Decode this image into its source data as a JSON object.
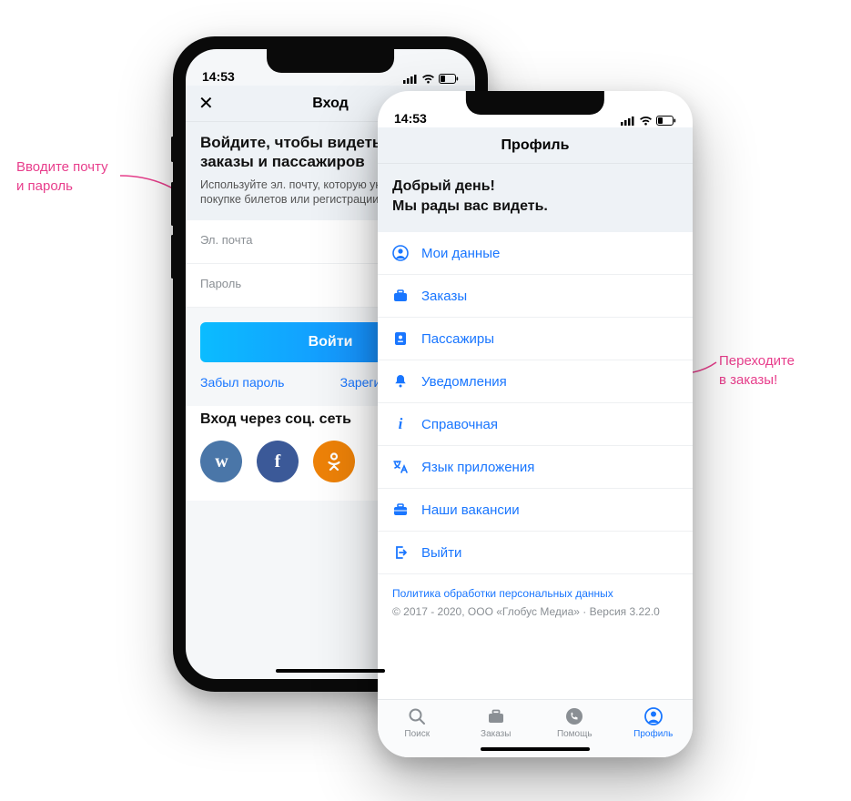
{
  "annot": {
    "left_line1": "Вводите почту",
    "left_line2": "и пароль",
    "right_line1": "Переходите",
    "right_line2": "в заказы!"
  },
  "status": {
    "time": "14:53"
  },
  "phoneA": {
    "nav_title": "Вход",
    "title": "Войдите, чтобы видеть свои заказы и пассажиров",
    "subtitle": "Используйте эл. почту, которую указывали при покупке билетов или регистрации на Туту.ру",
    "email_placeholder": "Эл. почта",
    "password_placeholder": "Пароль",
    "login_btn": "Войти",
    "forgot": "Забыл пароль",
    "register": "Зарегистрироваться",
    "social_title": "Вход через соц. сеть",
    "vk": "w",
    "fb": "f",
    "ok": "✽"
  },
  "phoneB": {
    "nav_title": "Профиль",
    "greet_line1": "Добрый день!",
    "greet_line2": "Мы рады вас видеть.",
    "menu": {
      "profile": "Мои данные",
      "orders": "Заказы",
      "passengers": "Пассажиры",
      "notifications": "Уведомления",
      "help": "Справочная",
      "language": "Язык приложения",
      "jobs": "Наши вакансии",
      "logout": "Выйти"
    },
    "privacy": "Политика обработки персональных данных",
    "copyright": "© 2017 - 2020, ООО «Глобус Медиа» · Версия 3.22.0",
    "tabs": {
      "search": "Поиск",
      "orders": "Заказы",
      "help": "Помощь",
      "profile": "Профиль"
    }
  }
}
